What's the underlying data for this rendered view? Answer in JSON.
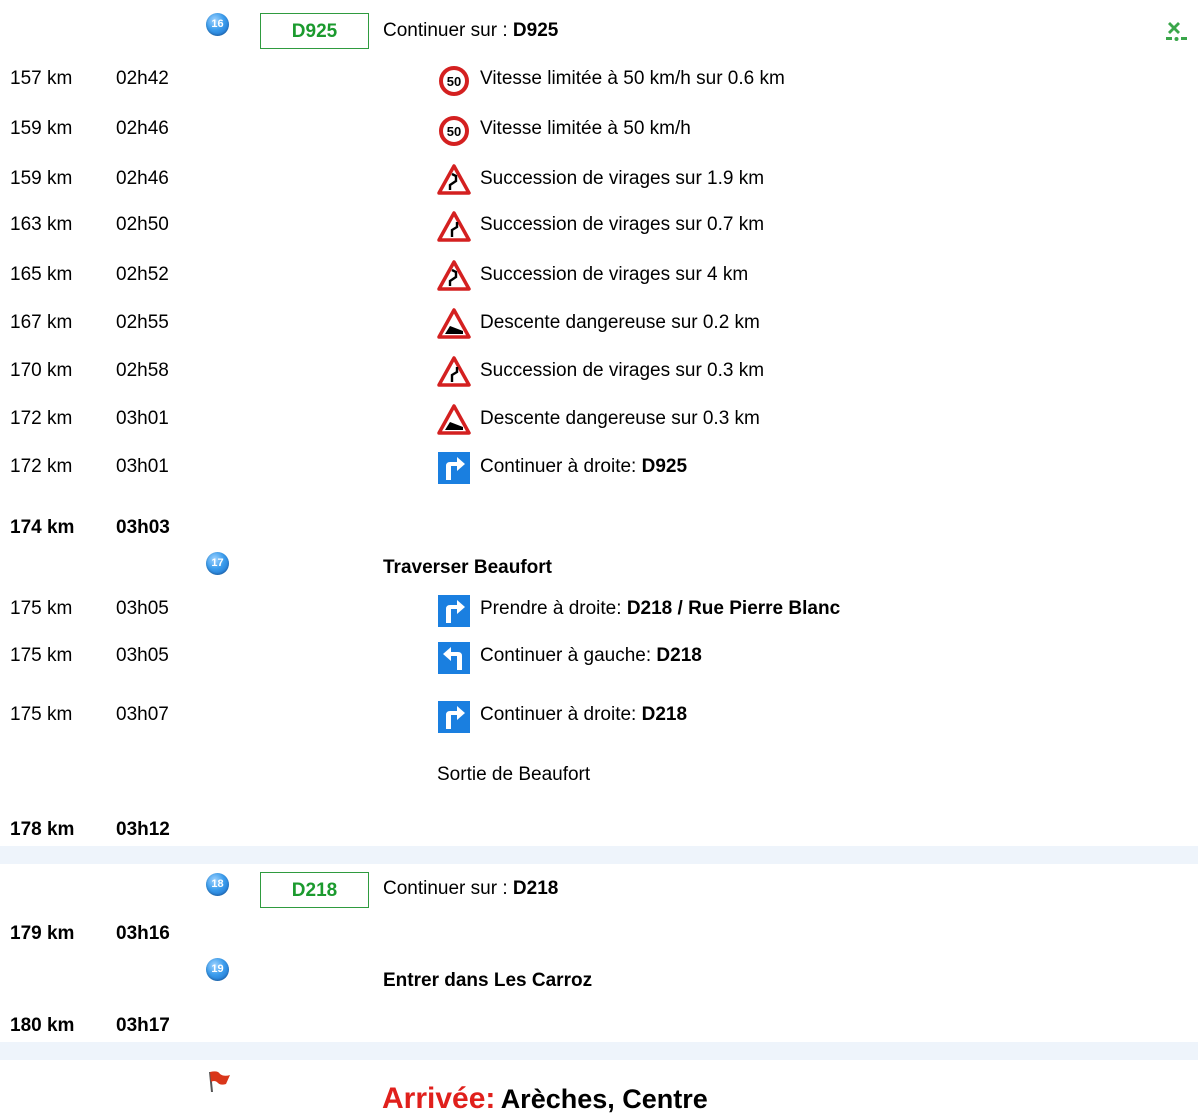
{
  "steps": [
    {
      "number": "16",
      "road": "D925",
      "label": "Continuer sur : ",
      "name": "D925"
    },
    {
      "number": "17",
      "label": "Traverser Beaufort"
    },
    {
      "number": "18",
      "road": "D218",
      "label": "Continuer sur : ",
      "name": "D218"
    },
    {
      "number": "19",
      "label": "Entrer dans Les Carroz"
    }
  ],
  "rows": [
    {
      "dist": "157 km",
      "time": "02h42",
      "icon": "speed-limit-50-icon",
      "text": "Vitesse limitée à 50 km/h sur 0.6 km"
    },
    {
      "dist": "159 km",
      "time": "02h46",
      "icon": "speed-limit-50-icon",
      "text": "Vitesse limitée à 50 km/h"
    },
    {
      "dist": "159 km",
      "time": "02h46",
      "icon": "winding-road-warning-icon",
      "text": "Succession de virages sur 1.9 km"
    },
    {
      "dist": "163 km",
      "time": "02h50",
      "icon": "winding-road-warning-icon",
      "text": "Succession de virages sur 0.7 km"
    },
    {
      "dist": "165 km",
      "time": "02h52",
      "icon": "winding-road-warning-icon",
      "text": "Succession de virages sur 4 km"
    },
    {
      "dist": "167 km",
      "time": "02h55",
      "icon": "steep-descent-warning-icon",
      "text": "Descente dangereuse sur 0.2 km"
    },
    {
      "dist": "170 km",
      "time": "02h58",
      "icon": "winding-road-warning-icon",
      "text": "Succession de virages sur 0.3 km"
    },
    {
      "dist": "172 km",
      "time": "03h01",
      "icon": "steep-descent-warning-icon",
      "text": "Descente dangereuse sur 0.3 km"
    },
    {
      "dist": "172 km",
      "time": "03h01",
      "icon": "turn-right-icon",
      "text": "Continuer à droite: ",
      "road": "D925"
    },
    {
      "dist": "175 km",
      "time": "03h05",
      "icon": "turn-right-icon",
      "text": "Prendre à droite: ",
      "road": "D218 / Rue Pierre Blanc"
    },
    {
      "dist": "175 km",
      "time": "03h05",
      "icon": "turn-left-icon",
      "text": "Continuer à gauche: ",
      "road": "D218"
    },
    {
      "dist": "175 km",
      "time": "03h07",
      "icon": "turn-right-icon",
      "text": "Continuer à droite: ",
      "road": "D218"
    }
  ],
  "milestones": [
    {
      "dist": "174 km",
      "time": "03h03"
    },
    {
      "dist": "178 km",
      "time": "03h12"
    },
    {
      "dist": "179 km",
      "time": "03h16"
    },
    {
      "dist": "180 km",
      "time": "03h17"
    }
  ],
  "sortie": "Sortie de Beaufort",
  "arrival": {
    "label": "Arrivée:",
    "place": "Arèches, Centre"
  },
  "colors": {
    "accent_green": "#1b9a2e",
    "arrival_red": "#e0201c",
    "step_blue": "#2f86dc",
    "band": "#eef4fb"
  }
}
